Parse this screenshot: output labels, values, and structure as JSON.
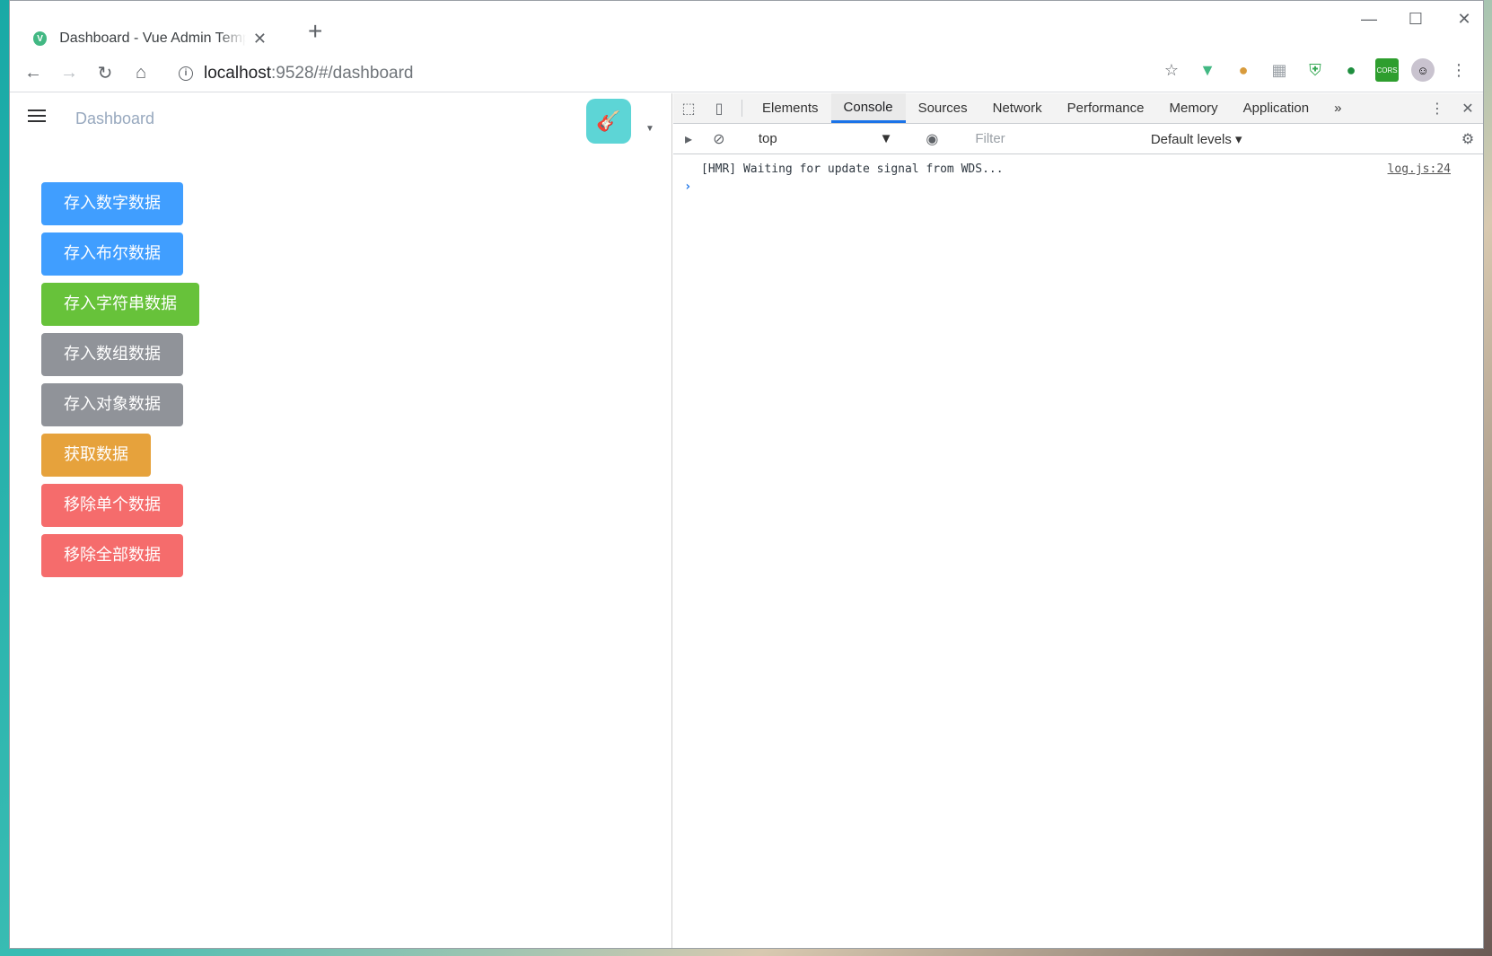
{
  "browser": {
    "tab_title": "Dashboard - Vue Admin Template",
    "tab_favicon": "V",
    "new_tab_label": "+",
    "url_host": "localhost",
    "url_rest": ":9528/#/dashboard"
  },
  "page": {
    "breadcrumb": "Dashboard",
    "buttons": [
      {
        "label": "存入数字数据",
        "type": "primary",
        "color": "#409eff"
      },
      {
        "label": "存入布尔数据",
        "type": "primary",
        "color": "#409eff"
      },
      {
        "label": "存入字符串数据",
        "type": "success",
        "color": "#67c23a"
      },
      {
        "label": "存入数组数据",
        "type": "info",
        "color": "#909399"
      },
      {
        "label": "存入对象数据",
        "type": "info",
        "color": "#909399"
      },
      {
        "label": "获取数据",
        "type": "warning",
        "color": "#e6a23c"
      },
      {
        "label": "移除单个数据",
        "type": "danger",
        "color": "#f56c6c"
      },
      {
        "label": "移除全部数据",
        "type": "danger",
        "color": "#f56c6c"
      }
    ]
  },
  "devtools": {
    "tabs": [
      "Elements",
      "Console",
      "Sources",
      "Network",
      "Performance",
      "Memory",
      "Application"
    ],
    "active_tab": "Console",
    "context": "top",
    "filter_placeholder": "Filter",
    "levels": "Default levels",
    "messages": [
      {
        "text": "[HMR] Waiting for update signal from WDS...",
        "source": "log.js:24"
      }
    ],
    "prompt": "›"
  }
}
